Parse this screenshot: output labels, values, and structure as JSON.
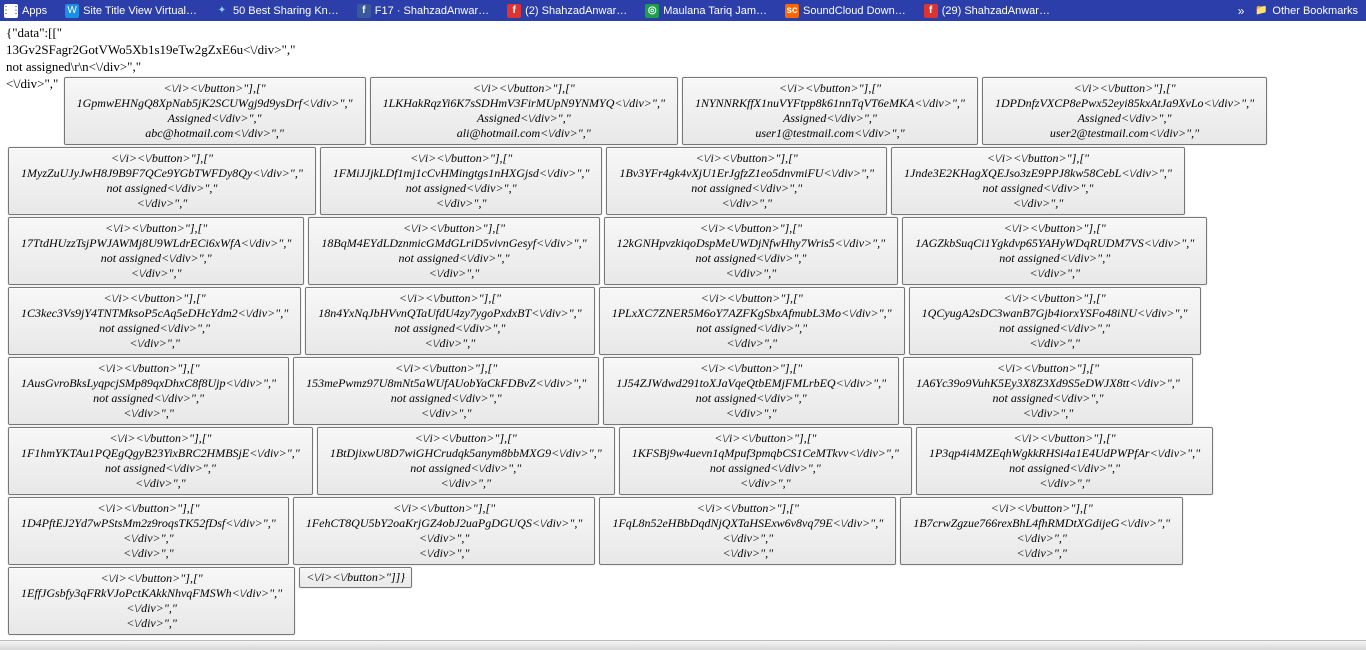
{
  "bookmarks": {
    "apps": "Apps",
    "items": [
      "Site Title View Virtual…",
      "50 Best Sharing Kn…",
      "F17 · ShahzadAnwar…",
      "(2) ShahzadAnwar…",
      "Maulana Tariq Jam…",
      "SoundCloud Down…",
      "(29) ShahzadAnwar…"
    ],
    "more": "»",
    "other": "Other Bookmarks"
  },
  "intro": [
    "{\"data\":[[\"",
    "13Gv2SFagr2GotVWo5Xb1s19eTw2gZxE6u<\\/div>\",\"",
    "not assigned\\r\\n<\\/div>\",\""
  ],
  "leadBeforeFirstCell": "<\\/div>\",\"",
  "cells": [
    {
      "l1": "<\\/i><\\/button>\"],[\"",
      "l2": "1GpmwEHNgQ8XpNab5jK2SCUWgj9d9ysDrf<\\/div>\",\"",
      "l3": "Assigned<\\/div>\",\"",
      "l4": "abc@hotmail.com<\\/div>\",\""
    },
    {
      "l1": "<\\/i><\\/button>\"],[\"",
      "l2": "1LKHakRqzYi6K7sSDHmV3FirMUpN9YNMYQ<\\/div>\",\"",
      "l3": "Assigned<\\/div>\",\"",
      "l4": "ali@hotmail.com<\\/div>\",\""
    },
    {
      "l1": "<\\/i><\\/button>\"],[\"",
      "l2": "1NYNNRKffX1nuVYFtpp8k61nnTqVT6eMKA<\\/div>\",\"",
      "l3": "Assigned<\\/div>\",\"",
      "l4": "user1@testmail.com<\\/div>\",\""
    },
    {
      "l1": "<\\/i><\\/button>\"],[\"",
      "l2": "1DPDnfzVXCP8ePwx52eyi85kxAtJa9XvLo<\\/div>\",\"",
      "l3": "Assigned<\\/div>\",\"",
      "l4": "user2@testmail.com<\\/div>\",\""
    },
    {
      "l1": "<\\/i><\\/button>\"],[\"",
      "l2": "1MyzZuUJyJwH8J9B9F7QCe9YGbTWFDy8Qy<\\/div>\",\"",
      "l3": "not assigned<\\/div>\",\"",
      "l4": "<\\/div>\",\""
    },
    {
      "l1": "<\\/i><\\/button>\"],[\"",
      "l2": "1FMiJJjkLDf1mj1cCvHMingtgs1nHXGjsd<\\/div>\",\"",
      "l3": "not assigned<\\/div>\",\"",
      "l4": "<\\/div>\",\""
    },
    {
      "l1": "<\\/i><\\/button>\"],[\"",
      "l2": "1Bv3YFr4gk4vXjU1ErJgfzZ1eo5dnvmiFU<\\/div>\",\"",
      "l3": "not assigned<\\/div>\",\"",
      "l4": "<\\/div>\",\""
    },
    {
      "l1": "<\\/i><\\/button>\"],[\"",
      "l2": "1Jnde3E2KHagXQEJso3zE9PPJ8kw58CebL<\\/div>\",\"",
      "l3": "not assigned<\\/div>\",\"",
      "l4": "<\\/div>\",\""
    },
    {
      "l1": "<\\/i><\\/button>\"],[\"",
      "l2": "17TtdHUzzTsjPWJAWMj8U9WLdrECi6xWfA<\\/div>\",\"",
      "l3": "not assigned<\\/div>\",\"",
      "l4": "<\\/div>\",\""
    },
    {
      "l1": "<\\/i><\\/button>\"],[\"",
      "l2": "18BqM4EYdLDznmicGMdGLriD5vivnGesyf<\\/div>\",\"",
      "l3": "not assigned<\\/div>\",\"",
      "l4": "<\\/div>\",\""
    },
    {
      "l1": "<\\/i><\\/button>\"],[\"",
      "l2": "12kGNHpvzkiqoDspMeUWDjNfwHhy7Wris5<\\/div>\",\"",
      "l3": "not assigned<\\/div>\",\"",
      "l4": "<\\/div>\",\""
    },
    {
      "l1": "<\\/i><\\/button>\"],[\"",
      "l2": "1AGZkbSuqCi1Ygkdvp65YAHyWDqRUDM7VS<\\/div>\",\"",
      "l3": "not assigned<\\/div>\",\"",
      "l4": "<\\/div>\",\""
    },
    {
      "l1": "<\\/i><\\/button>\"],[\"",
      "l2": "1C3kec3Vs9jY4TNTMksoP5cAq5eDHcYdm2<\\/div>\",\"",
      "l3": "not assigned<\\/div>\",\"",
      "l4": "<\\/div>\",\""
    },
    {
      "l1": "<\\/i><\\/button>\"],[\"",
      "l2": "18n4YxNqJbHVvnQTaUfdU4zy7ygoPxdxBT<\\/div>\",\"",
      "l3": "not assigned<\\/div>\",\"",
      "l4": "<\\/div>\",\""
    },
    {
      "l1": "<\\/i><\\/button>\"],[\"",
      "l2": "1PLxXC7ZNER5M6oY7AZFKgSbxAfmubL3Mo<\\/div>\",\"",
      "l3": "not assigned<\\/div>\",\"",
      "l4": "<\\/div>\",\""
    },
    {
      "l1": "<\\/i><\\/button>\"],[\"",
      "l2": "1QCyugA2sDC3wanB7Gjb4iorxYSFo48iNU<\\/div>\",\"",
      "l3": "not assigned<\\/div>\",\"",
      "l4": "<\\/div>\",\""
    },
    {
      "l1": "<\\/i><\\/button>\"],[\"",
      "l2": "1AusGvroBksLyqpcjSMp89qxDhxC8f8Ujp<\\/div>\",\"",
      "l3": "not assigned<\\/div>\",\"",
      "l4": "<\\/div>\",\""
    },
    {
      "l1": "<\\/i><\\/button>\"],[\"",
      "l2": "153mePwmz97U8mNt5aWUfAUobYaCkFDBvZ<\\/div>\",\"",
      "l3": "not assigned<\\/div>\",\"",
      "l4": "<\\/div>\",\""
    },
    {
      "l1": "<\\/i><\\/button>\"],[\"",
      "l2": "1J54ZJWdwd291toXJaVqeQtbEMjFMLrbEQ<\\/div>\",\"",
      "l3": "not assigned<\\/div>\",\"",
      "l4": "<\\/div>\",\""
    },
    {
      "l1": "<\\/i><\\/button>\"],[\"",
      "l2": "1A6Yc39o9VuhK5Ey3X8Z3Xd9S5eDWJX8tt<\\/div>\",\"",
      "l3": "not assigned<\\/div>\",\"",
      "l4": "<\\/div>\",\""
    },
    {
      "l1": "<\\/i><\\/button>\"],[\"",
      "l2": "1F1hmYKTAu1PQEgQgyB23YixBRC2HMBSjE<\\/div>\",\"",
      "l3": "not assigned<\\/div>\",\"",
      "l4": "<\\/div>\",\""
    },
    {
      "l1": "<\\/i><\\/button>\"],[\"",
      "l2": "1BtDjixwU8D7wiGHCrudqk5anym8bbMXG9<\\/div>\",\"",
      "l3": "not assigned<\\/div>\",\"",
      "l4": "<\\/div>\",\""
    },
    {
      "l1": "<\\/i><\\/button>\"],[\"",
      "l2": "1KFSBj9w4uevn1qMpuf3pmqbCS1CeMTkvv<\\/div>\",\"",
      "l3": "not assigned<\\/div>\",\"",
      "l4": "<\\/div>\",\""
    },
    {
      "l1": "<\\/i><\\/button>\"],[\"",
      "l2": "1P3qp4i4MZEqhWgkkRHSi4a1E4UdPWPfAr<\\/div>\",\"",
      "l3": "not assigned<\\/div>\",\"",
      "l4": "<\\/div>\",\""
    },
    {
      "l1": "<\\/i><\\/button>\"],[\"",
      "l2": "1D4PftEJ2Yd7wPStsMm2z9roqsTK52fDsf<\\/div>\",\"",
      "l3": "<\\/div>\",\"",
      "l4": "<\\/div>\",\""
    },
    {
      "l1": "<\\/i><\\/button>\"],[\"",
      "l2": "1FehCT8QU5bY2oaKrjGZ4obJ2uaPgDGUQS<\\/div>\",\"",
      "l3": "<\\/div>\",\"",
      "l4": "<\\/div>\",\""
    },
    {
      "l1": "<\\/i><\\/button>\"],[\"",
      "l2": "1FqL8n52eHBbDqdNjQXTaHSExw6v8vq79E<\\/div>\",\"",
      "l3": "<\\/div>\",\"",
      "l4": "<\\/div>\",\""
    },
    {
      "l1": "<\\/i><\\/button>\"],[\"",
      "l2": "1B7crwZgzue766rexBhL4fhRMDtXGdijeG<\\/div>\",\"",
      "l3": "<\\/div>\",\"",
      "l4": "<\\/div>\",\""
    },
    {
      "l1": "<\\/i><\\/button>\"],[\"",
      "l2": "1EffJGsbfy3qFRkVJoPctKAkkNhvqFMSWh<\\/div>\",\"",
      "l3": "<\\/div>\",\"",
      "l4": "<\\/div>\",\""
    }
  ],
  "tailCell": "<\\/i><\\/button>\"]]}"
}
